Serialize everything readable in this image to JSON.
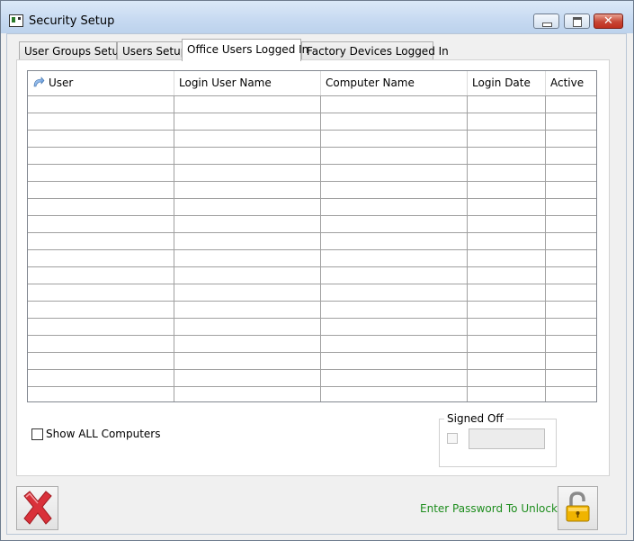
{
  "window": {
    "title": "Security Setup"
  },
  "tabs": [
    {
      "label": "User Groups Setup",
      "active": false
    },
    {
      "label": "Users Setup",
      "active": false
    },
    {
      "label": "Office Users Logged In",
      "active": true
    },
    {
      "label": "Factory Devices Logged In",
      "active": false
    }
  ],
  "grid": {
    "columns": [
      {
        "label": "User",
        "icon": "sort-icon"
      },
      {
        "label": "Login User Name"
      },
      {
        "label": "Computer Name"
      },
      {
        "label": "Login Date"
      },
      {
        "label": "Active"
      }
    ],
    "rows": []
  },
  "options": {
    "show_all_label": "Show ALL Computers",
    "show_all_checked": false
  },
  "signed_off": {
    "title": "Signed Off",
    "checked": false,
    "value": ""
  },
  "footer": {
    "unlock_text": "Enter Password To Unlock"
  },
  "colors": {
    "unlock_text": "#1d8d1d",
    "close_x": "#d9313a",
    "lock_body": "#f0b400"
  },
  "icons": {
    "close_button": "red-x-icon",
    "lock_button": "padlock-icon"
  }
}
